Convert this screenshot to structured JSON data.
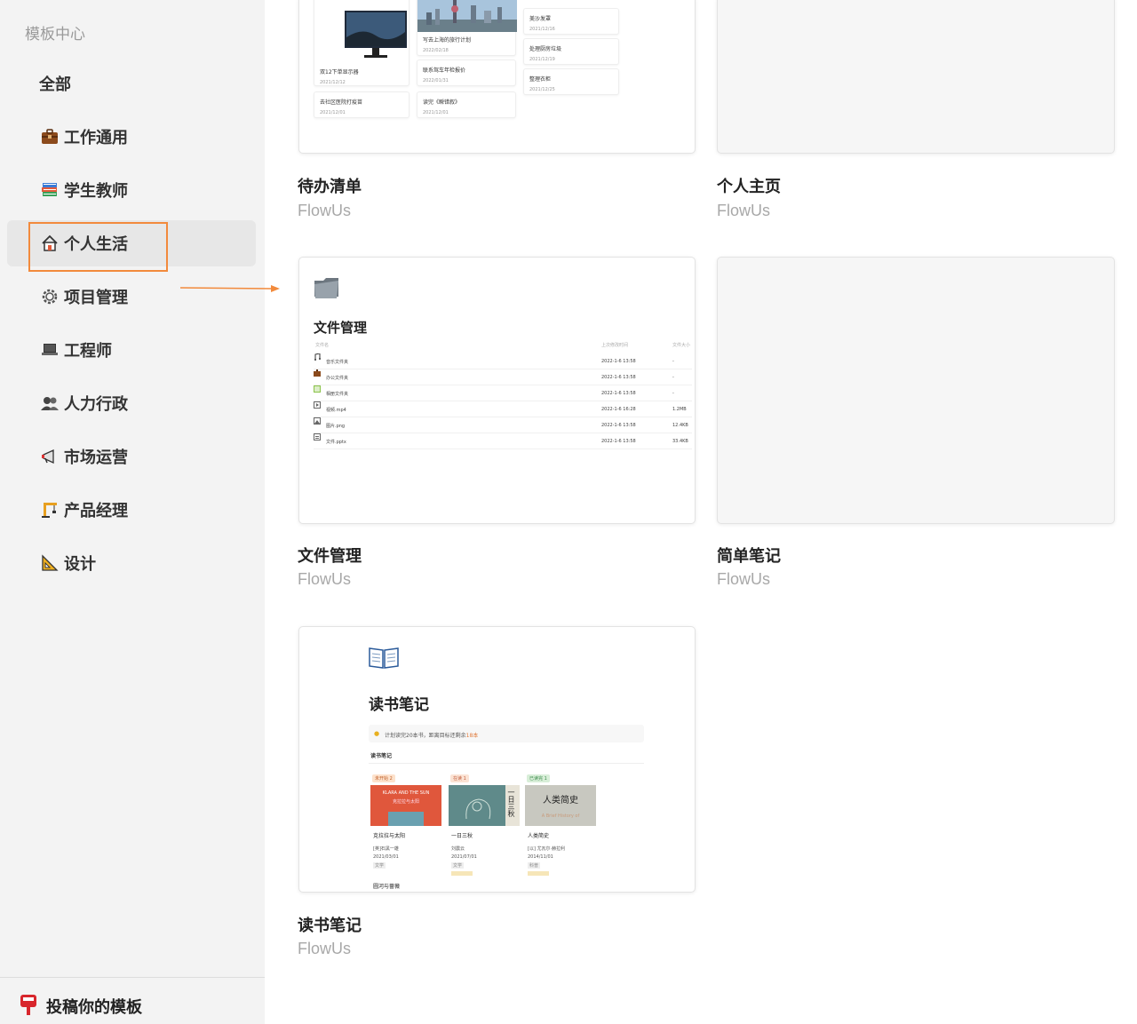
{
  "sidebar": {
    "title": "模板中心",
    "items": [
      {
        "label": "全部"
      },
      {
        "label": "工作通用",
        "icon": "briefcase-icon"
      },
      {
        "label": "学生教师",
        "icon": "books-icon"
      },
      {
        "label": "个人生活",
        "icon": "house-icon",
        "active": true
      },
      {
        "label": "项目管理",
        "icon": "gear-icon"
      },
      {
        "label": "工程师",
        "icon": "laptop-icon"
      },
      {
        "label": "人力行政",
        "icon": "people-icon"
      },
      {
        "label": "市场运营",
        "icon": "megaphone-icon"
      },
      {
        "label": "产品经理",
        "icon": "crane-icon"
      },
      {
        "label": "设计",
        "icon": "triangle-ruler-icon"
      }
    ],
    "submit_label": "投稿你的模板"
  },
  "cards": [
    {
      "title": "待办清单",
      "author": "FlowUs"
    },
    {
      "title": "个人主页",
      "author": "FlowUs"
    },
    {
      "title": "文件管理",
      "author": "FlowUs"
    },
    {
      "title": "简单笔记",
      "author": "FlowUs"
    },
    {
      "title": "读书笔记",
      "author": "FlowUs"
    }
  ],
  "todo_preview": {
    "tiles": [
      {
        "title": "双12下单显示器",
        "date": "2021/12/12"
      },
      {
        "title": "去社区医院打疫苗",
        "date": "2021/12/01"
      },
      {
        "title": "写去上海的旅行计划",
        "date": "2022/02/18"
      },
      {
        "title": "联系驾车年检报价",
        "date": "2022/01/31"
      },
      {
        "title": "读完《瞬错叙》",
        "date": "2021/12/01"
      },
      {
        "title": "美沙发罩",
        "date": "2021/12/16"
      },
      {
        "title": "处理厨房垃圾",
        "date": "2021/12/19"
      },
      {
        "title": "整理衣柜",
        "date": "2021/12/25"
      }
    ]
  },
  "file_preview": {
    "title": "文件管理",
    "headers": {
      "name": "文件名",
      "modified": "上次修改时间",
      "size": "文件大小"
    },
    "rows": [
      {
        "name": "音乐文件夹",
        "modified": "2022-1-6 13:58",
        "size": "-"
      },
      {
        "name": "办公文件夹",
        "modified": "2022-1-6 13:58",
        "size": "-"
      },
      {
        "name": "相册文件夹",
        "modified": "2022-1-6 13:58",
        "size": "-"
      },
      {
        "name": "视频.mp4",
        "modified": "2022-1-6 16:28",
        "size": "1.2MB"
      },
      {
        "name": "图片.png",
        "modified": "2022-1-6 13:58",
        "size": "12.4KB"
      },
      {
        "name": "文件.pptx",
        "modified": "2022-1-6 13:58",
        "size": "33.4KB"
      }
    ]
  },
  "reading_preview": {
    "title": "读书笔记",
    "tip": "计划读完20本书，距离目标还剩余",
    "tip_highlight": "18本",
    "section": "读书笔记",
    "books": [
      {
        "status": "未开始",
        "count": "2",
        "cover_title": "KLARA AND THE SUN",
        "cover_sub": "克拉拉与太阳",
        "title": "克拉拉与太阳",
        "author": "[英]石黑一雄",
        "date": "2021/03/01",
        "genre": "文学"
      },
      {
        "status": "在读",
        "count": "1",
        "cover_title": "一日三秋",
        "cover_sub": "",
        "title": "一日三秋",
        "author": "刘震云",
        "date": "2021/07/01",
        "genre": "文学"
      },
      {
        "status": "已读完",
        "count": "1",
        "cover_title": "人类简史",
        "cover_sub": "A Brief History of",
        "title": "人类简史",
        "author": "[以] 尤瓦尔·赫拉利",
        "date": "2014/11/01",
        "genre": "科普"
      }
    ],
    "extra_title": "圆河与蔷薇"
  },
  "colors": {
    "accent": "#f28a3c",
    "sidebar_bg": "#f3f3f3"
  }
}
